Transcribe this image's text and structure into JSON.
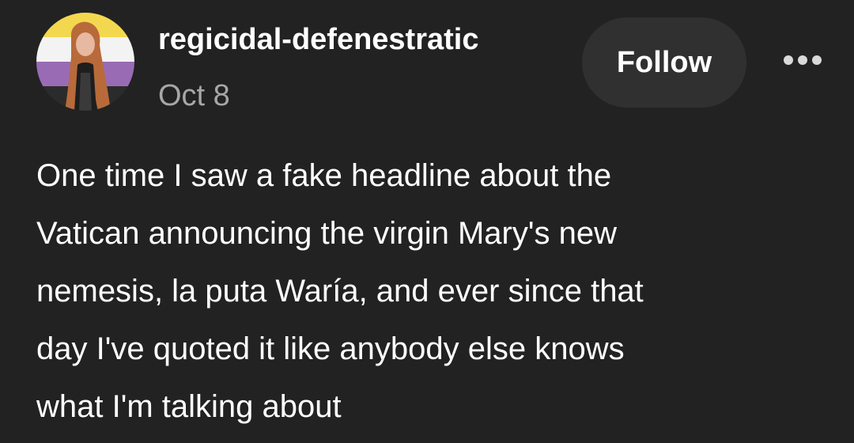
{
  "post": {
    "author": {
      "username": "regicidal-defenestratic",
      "avatar_icon": "profile-photo-icon",
      "avatar_flag_colors": [
        "#f3d84f",
        "#f3f3f3",
        "#9a6bb5",
        "#2b2b2b"
      ]
    },
    "date": "Oct 8",
    "follow_label": "Follow",
    "more_icon": "more-options-icon",
    "body_lines": [
      "One time I saw a fake headline about the",
      "Vatican announcing the virgin Mary's new",
      "nemesis, la puta Waría, and ever since that",
      "day I've quoted it like anybody else knows",
      "what I'm talking about"
    ]
  },
  "colors": {
    "background": "#222222",
    "button_bg": "#303030",
    "date_text": "#a7a7a7",
    "primary_text": "#ffffff"
  }
}
